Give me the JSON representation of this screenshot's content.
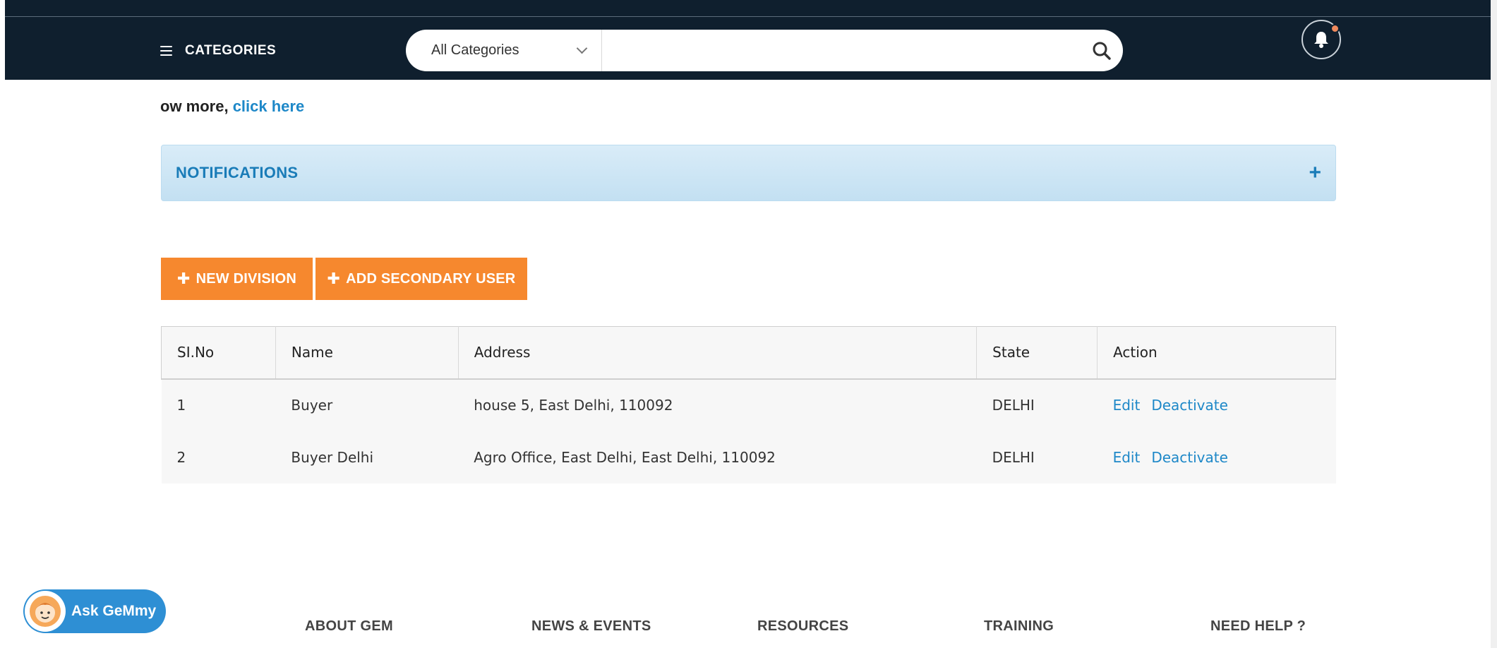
{
  "header": {
    "categories_label": "CATEGORIES",
    "search": {
      "category_selected": "All Categories",
      "placeholder": ""
    }
  },
  "info_line": {
    "prefix": "ow more, ",
    "link": "click here"
  },
  "notifications": {
    "title": "NOTIFICATIONS",
    "toggle": "+"
  },
  "actions": {
    "new_division": "NEW DIVISION",
    "add_secondary_user": "ADD SECONDARY USER"
  },
  "table": {
    "headers": [
      "SI.No",
      "Name",
      "Address",
      "State",
      "Action"
    ],
    "rows": [
      {
        "no": "1",
        "name": "Buyer",
        "address": "house 5, East Delhi, 110092",
        "state": "DELHI",
        "edit": "Edit",
        "deactivate": "Deactivate"
      },
      {
        "no": "2",
        "name": "Buyer Delhi",
        "address": "Agro Office, East Delhi, East Delhi, 110092",
        "state": "DELHI",
        "edit": "Edit",
        "deactivate": "Deactivate"
      }
    ]
  },
  "chatbot": {
    "label": "Ask GeMmy"
  },
  "footer": {
    "links": [
      "ABOUT GEM",
      "NEWS & EVENTS",
      "RESOURCES",
      "TRAINING",
      "NEED HELP ?"
    ]
  },
  "colors": {
    "navbar": "#0f1f2e",
    "accent_orange": "#f6882e",
    "link_blue": "#1e88c8",
    "notification_bg": "#c3e0f2",
    "chatbot_blue": "#2e8fd4",
    "badge_dot": "#f08a5d"
  },
  "icons": {
    "menu": "hamburger-icon",
    "dropdown": "chevron-down-icon",
    "search": "search-icon",
    "notifications": "bell-icon",
    "chatbot": "assistant-avatar-icon"
  }
}
